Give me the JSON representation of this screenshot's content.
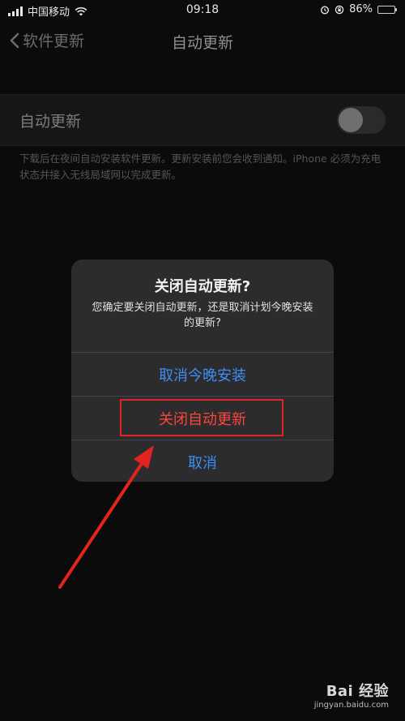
{
  "status_bar": {
    "carrier": "中国移动",
    "time": "09:18",
    "battery": "86%",
    "battery_level": 0.86,
    "icons": [
      "signal-icon",
      "wifi-icon",
      "alarm-icon",
      "orientation-lock-icon",
      "battery-icon"
    ]
  },
  "nav": {
    "back_label": "软件更新",
    "title": "自动更新"
  },
  "settings": {
    "auto_update_label": "自动更新",
    "auto_update_on": false,
    "footnote": "下载后在夜间自动安装软件更新。更新安装前您会收到通知。iPhone 必须为充电状态并接入无线局域网以完成更新。"
  },
  "alert": {
    "title": "关闭自动更新?",
    "message": "您确定要关闭自动更新，还是取消计划今晚安装的更新?",
    "buttons": {
      "cancel_tonight": "取消今晚安装",
      "turn_off": "关闭自动更新",
      "cancel": "取消"
    }
  },
  "annotation": {
    "highlight_color": "#e0241f"
  },
  "watermark": {
    "logo": "Bai 经验",
    "url": "jingyan.baidu.com"
  },
  "colors": {
    "ios_blue": "#3d8ef0",
    "ios_red": "#ff453a"
  }
}
